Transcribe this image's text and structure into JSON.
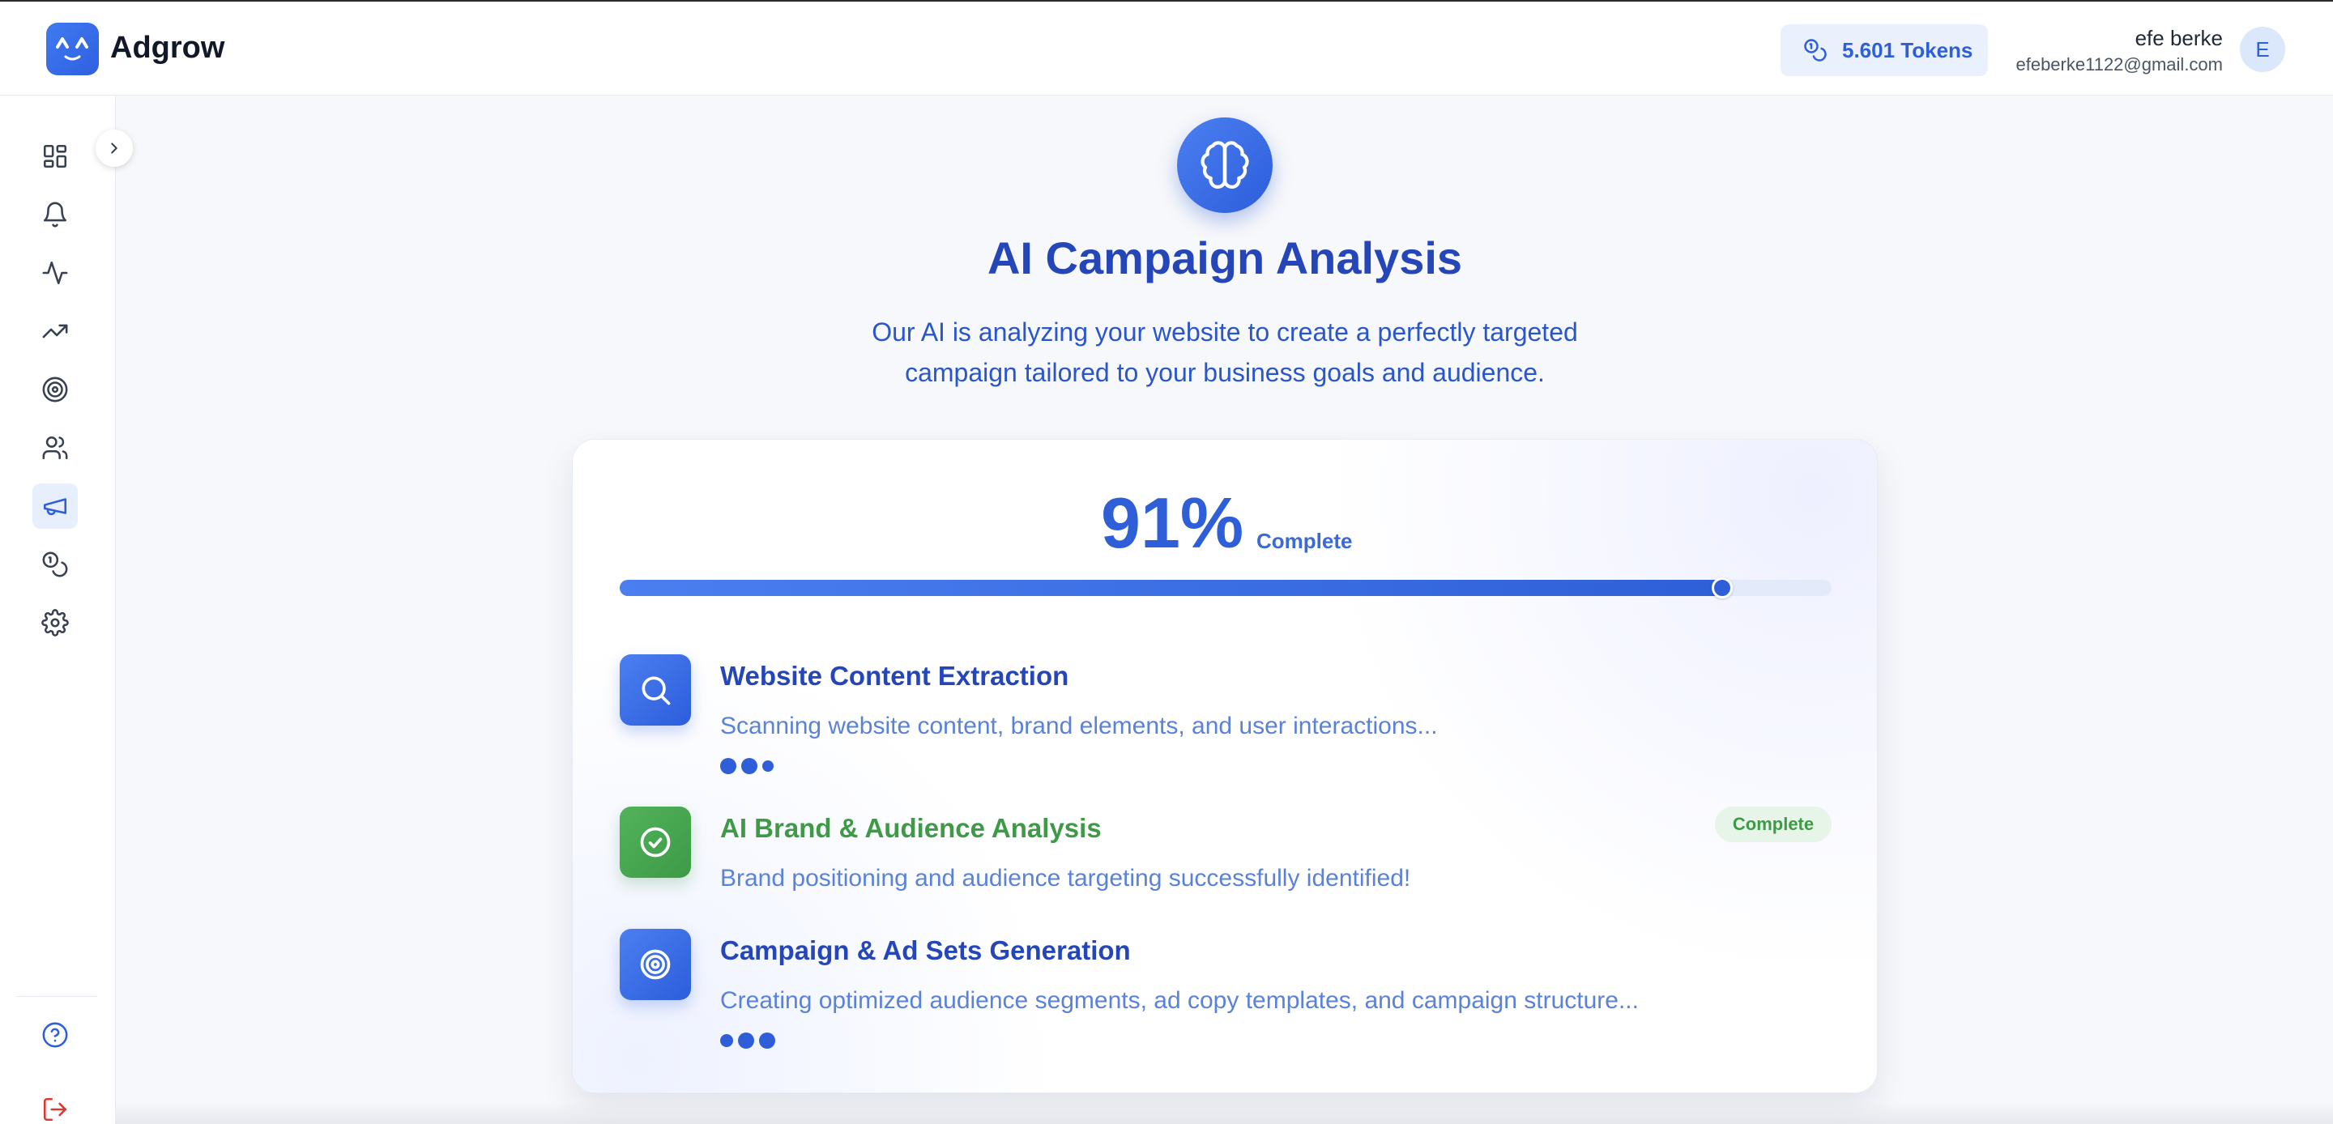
{
  "app": {
    "brand": "Adgrow",
    "tokens_label": "5.601 Tokens",
    "user_name": "efe berke",
    "user_email": "efeberke1122@gmail.com",
    "avatar_initial": "E"
  },
  "sidebar": {
    "items": [
      {
        "icon": "dashboard-icon"
      },
      {
        "icon": "bell-icon"
      },
      {
        "icon": "activity-icon"
      },
      {
        "icon": "trending-up-icon"
      },
      {
        "icon": "target-icon"
      },
      {
        "icon": "users-icon"
      },
      {
        "icon": "megaphone-icon",
        "active": true
      },
      {
        "icon": "coins-icon"
      },
      {
        "icon": "settings-icon"
      }
    ],
    "bottom": [
      {
        "icon": "help-icon"
      },
      {
        "icon": "logout-icon"
      }
    ]
  },
  "main": {
    "title": "AI Campaign Analysis",
    "subtitle": "Our AI is analyzing your website to create a perfectly targeted campaign tailored to your business goals and audience.",
    "progress_percent": 91,
    "progress_text": "91%",
    "progress_label": "Complete",
    "steps": [
      {
        "title": "Website Content Extraction",
        "description": "Scanning website content, brand elements, and user interactions...",
        "status": "in-progress",
        "icon": "search-icon"
      },
      {
        "title": "AI Brand & Audience Analysis",
        "description": "Brand positioning and audience targeting successfully identified!",
        "status": "complete",
        "badge": "Complete",
        "icon": "check-circle-icon"
      },
      {
        "title": "Campaign & Ad Sets Generation",
        "description": "Creating optimized audience segments, ad copy templates, and campaign structure...",
        "status": "in-progress",
        "icon": "target-icon"
      }
    ]
  },
  "colors": {
    "accent": "#2f5fd8",
    "title": "#2546b8",
    "success": "#3f9a48"
  }
}
